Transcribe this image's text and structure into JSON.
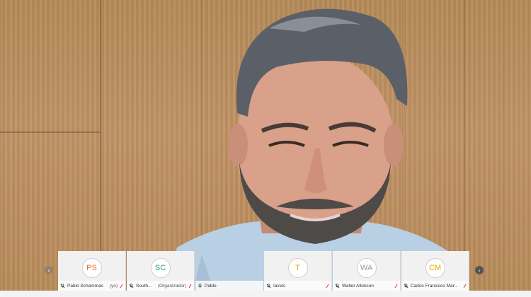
{
  "participants": [
    {
      "initials": "PS",
      "name": "Pablo Schammas",
      "suffix": "(yo)",
      "color": "#e37a2e"
    },
    {
      "initials": "SC",
      "name": "South...",
      "suffix": "(Organizador)",
      "color": "#1e9c8c"
    },
    {
      "initials": "",
      "name": "Pablo",
      "suffix": "",
      "color": "#333333"
    },
    {
      "initials": "T",
      "name": "Iavels",
      "suffix": "",
      "color": "#f0a400"
    },
    {
      "initials": "WA",
      "name": "Walter Atkinson",
      "suffix": "",
      "color": "#9a9a9a"
    },
    {
      "initials": "CM",
      "name": "Carlos Francisco Mar...",
      "suffix": "",
      "color": "#f0a400"
    }
  ],
  "nav": {
    "prev_glyph": "‹",
    "next_glyph": "›"
  },
  "icons": {
    "mic": "mic-muted-icon",
    "signal": "signal-icon"
  }
}
